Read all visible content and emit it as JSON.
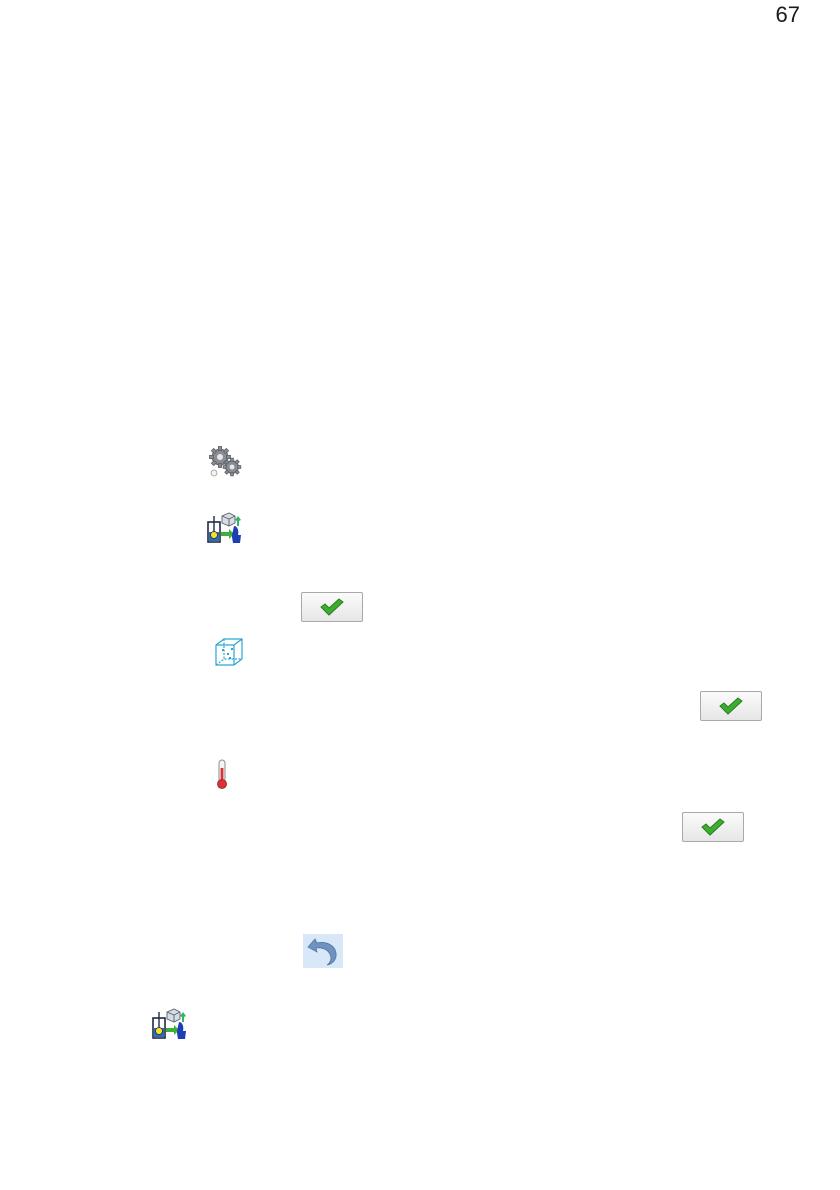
{
  "page": {
    "number": "67"
  },
  "icons": {
    "settings": "settings-gears-icon",
    "adjustment": "adjustment-procedure-icon",
    "confirm": "checkmark-icon",
    "chamber": "chamber-cube-icon",
    "temperature": "thermometer-icon",
    "back": "undo-arrow-icon"
  },
  "colors": {
    "check_green": "#3cae2f",
    "back_arrow": "#6f93c0",
    "back_bg": "#d9e8f8",
    "thermo_red": "#d9333a",
    "cube_cyan": "#2aa6d6"
  }
}
